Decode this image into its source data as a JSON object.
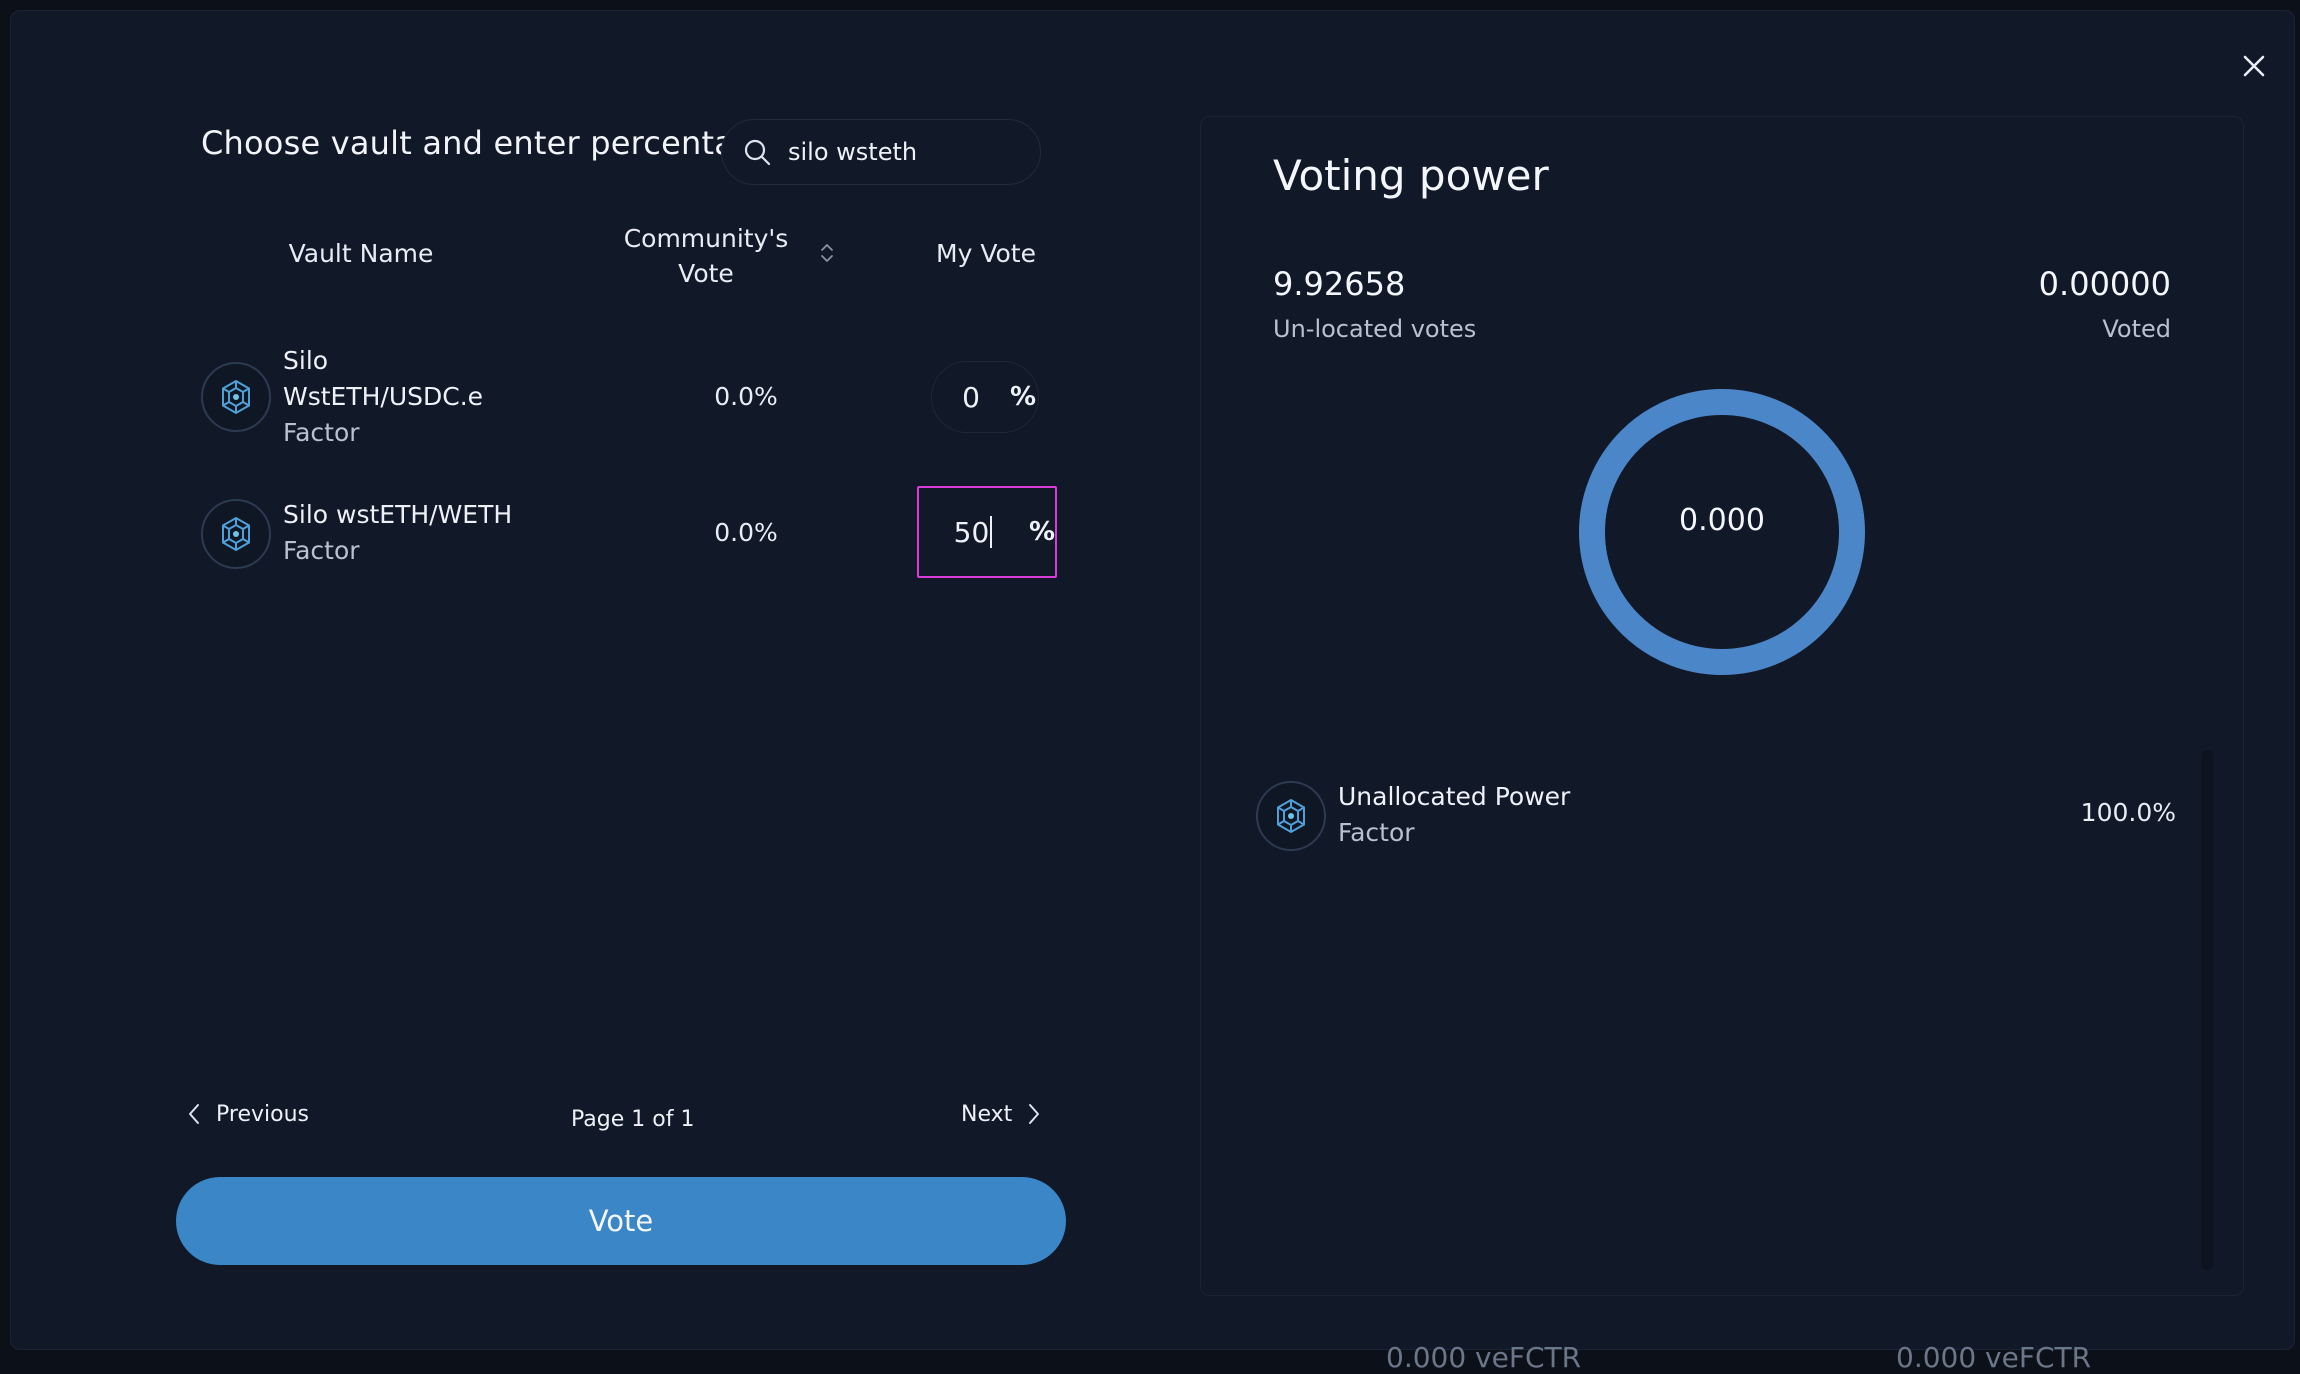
{
  "left": {
    "title": "Choose vault and enter percentage",
    "search": {
      "value": "silo wsteth"
    },
    "columns": {
      "vault_name": "Vault Name",
      "community_vote": "Community's Vote",
      "my_vote": "My Vote"
    },
    "rows": [
      {
        "name_line1": "Silo",
        "name_line2": "WstETH/USDC.e",
        "sub": "Factor",
        "community": "0.0%",
        "my_vote": "0",
        "unit": "%"
      },
      {
        "name_line1": "Silo wstETH/WETH",
        "sub": "Factor",
        "community": "0.0%",
        "my_vote": "50",
        "unit": "%"
      }
    ],
    "pager": {
      "previous": "Previous",
      "page_info": "Page 1 of 1",
      "next": "Next"
    },
    "vote_button": "Vote"
  },
  "right": {
    "title": "Voting power",
    "unlocated": {
      "value": "9.92658",
      "label": "Un-located votes"
    },
    "voted": {
      "value": "0.00000",
      "label": "Voted"
    },
    "donut": {
      "center": "0.000",
      "color": "#4a86c8"
    },
    "allocations": [
      {
        "name": "Unallocated Power",
        "sub": "Factor",
        "pct": "100.0%"
      }
    ]
  },
  "background_partial": {
    "left": "0.000 veFCTR",
    "right": "0.000 veFCTR"
  },
  "colors": {
    "accent": "#3b86c6",
    "focus_outline": "#d93ad9",
    "background": "#111827"
  },
  "icons": [
    "close-icon",
    "search-icon",
    "sort-icon",
    "factor-logo-icon",
    "chevron-left-icon",
    "chevron-right-icon"
  ]
}
